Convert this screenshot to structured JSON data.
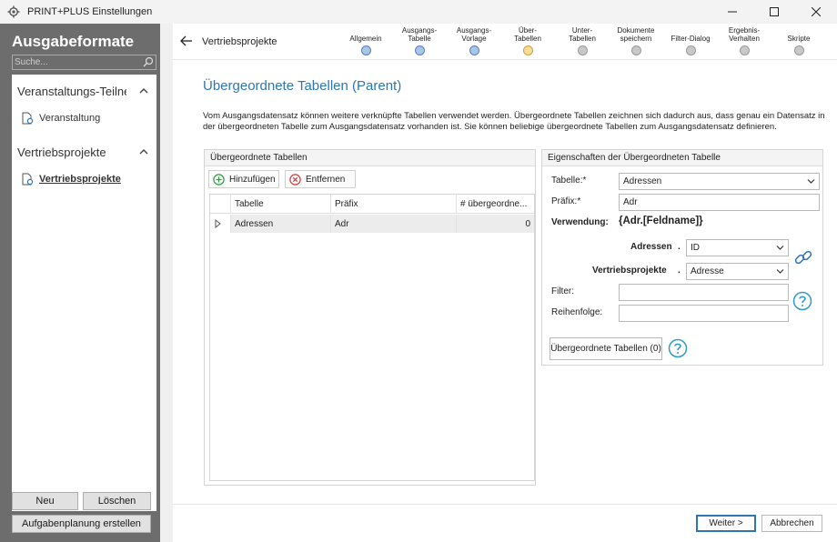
{
  "window": {
    "title": "PRINT+PLUS Einstellungen"
  },
  "sidebar": {
    "title": "Ausgabeformate",
    "search_placeholder": "Suche...",
    "groups": [
      {
        "label": "Veranstaltungs-Teilneh",
        "items": [
          {
            "label": "Veranstaltung"
          }
        ]
      },
      {
        "label": "Vertriebsprojekte",
        "items": [
          {
            "label": "Vertriebsprojekte",
            "active": true
          }
        ]
      }
    ],
    "buttons": {
      "new": "Neu",
      "delete": "Löschen",
      "schedule": "Aufgabenplanung erstellen"
    }
  },
  "header": {
    "breadcrumb": "Vertriebsprojekte",
    "steps": [
      {
        "label": "Allgemein",
        "state": "done"
      },
      {
        "label": "Ausgangs-\nTabelle",
        "state": "done"
      },
      {
        "label": "Ausgangs-\nVorlage",
        "state": "done"
      },
      {
        "label": "Über-\nTabellen",
        "state": "current"
      },
      {
        "label": "Unter-\nTabellen",
        "state": "todo"
      },
      {
        "label": "Dokumente\nspeichern",
        "state": "todo"
      },
      {
        "label": "Filter-Dialog",
        "state": "todo"
      },
      {
        "label": "Ergebnis-\nVerhalten",
        "state": "todo"
      },
      {
        "label": "Skripte",
        "state": "todo"
      }
    ]
  },
  "content": {
    "title": "Übergeordnete Tabellen (Parent)",
    "description": "Vom Ausgangsdatensatz können weitere verknüpfte Tabellen verwendet werden. Übergeordnete Tabellen zeichnen sich dadurch aus, dass genau ein Datensatz in der übergeordneten Tabelle zum Ausgangsdatensatz vorhanden ist. Sie können beliebige übergeordnete Tabellen zum Ausgangsdatensatz definieren."
  },
  "tables_panel": {
    "header": "Übergeordnete Tabellen",
    "add_label": "Hinzufügen",
    "remove_label": "Entfernen",
    "columns": [
      "Tabelle",
      "Präfix",
      "# übergeordne..."
    ],
    "rows": [
      {
        "table": "Adressen",
        "prefix": "Adr",
        "count": "0"
      }
    ]
  },
  "properties_panel": {
    "header": "Eigenschaften der Übergeordneten Tabelle",
    "table_label": "Tabelle:*",
    "table_value": "Adressen",
    "prefix_label": "Präfix:*",
    "prefix_value": "Adr",
    "usage_label": "Verwendung:",
    "usage_value": "{Adr.[Feldname]}",
    "link_left_label": "Adressen",
    "link_left_dot": ".",
    "link_left_value": "ID",
    "link_right_label": "Vertriebsprojekte",
    "link_right_dot": ".",
    "link_right_value": "Adresse",
    "filter_label": "Filter:",
    "filter_value": "",
    "sort_label": "Reihenfolge:",
    "sort_value": "",
    "subtables_button": "Übergeordnete Tabellen (0)"
  },
  "footer": {
    "next_label": "Weiter >",
    "cancel_label": "Abbrechen"
  },
  "colors": {
    "accent": "#2e75b6",
    "sidebar_bg": "#6d6d6d",
    "step_done": "#a9c6ea",
    "step_current": "#f7dc9a",
    "step_todo": "#c8c8c8"
  }
}
